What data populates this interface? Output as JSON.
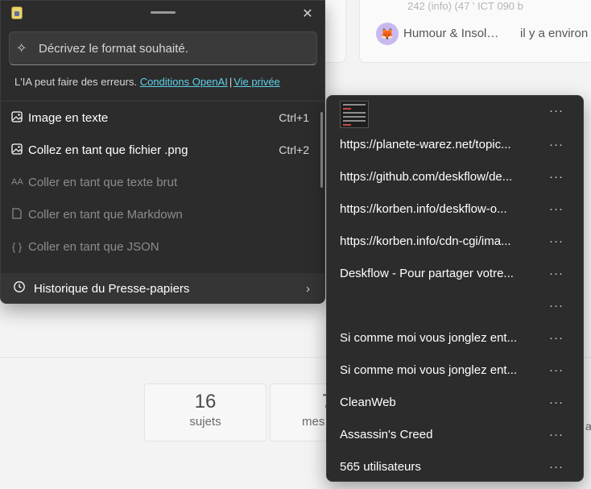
{
  "background": {
    "top_cut_text": "242 (info) (47 ' ICT 090 b",
    "category": "Humour & Insol…",
    "time_text": "il y a environ",
    "stats": [
      {
        "num": "16",
        "label": "sujets"
      },
      {
        "num": "7",
        "label": "mes"
      }
    ],
    "edge_char": "a"
  },
  "paste_menu": {
    "close_glyph": "✕",
    "prompt_placeholder": "Décrivez le format souhaité.",
    "disclaimer": "L'IA peut faire des erreurs.",
    "link_terms": "Conditions OpenAI",
    "separator": "|",
    "link_privacy": "Vie privée",
    "items": [
      {
        "label": "Image en texte",
        "shortcut": "Ctrl+1",
        "icon": "image-icon",
        "enabled": true
      },
      {
        "label": "Collez en tant que fichier .png",
        "shortcut": "Ctrl+2",
        "icon": "image-file-icon",
        "enabled": true
      },
      {
        "label": "Coller en tant que texte brut",
        "shortcut": "",
        "icon": "text-size-icon",
        "enabled": false
      },
      {
        "label": "Coller en tant que Markdown",
        "shortcut": "",
        "icon": "document-icon",
        "enabled": false
      },
      {
        "label": "Coller en tant que JSON",
        "shortcut": "",
        "icon": "braces-icon",
        "enabled": false
      }
    ],
    "history_label": "Historique du Presse-papiers",
    "history_chevron": "›"
  },
  "clipboard_history": {
    "more_glyph": "···",
    "items": [
      {
        "type": "image",
        "text": ""
      },
      {
        "type": "text",
        "text": "https://planete-warez.net/topic..."
      },
      {
        "type": "text",
        "text": "https://github.com/deskflow/de..."
      },
      {
        "type": "text",
        "text": "https://korben.info/deskflow-o..."
      },
      {
        "type": "text",
        "text": "https://korben.info/cdn-cgi/ima..."
      },
      {
        "type": "text",
        "text": "Deskflow - Pour partager votre..."
      },
      {
        "type": "text",
        "text": ""
      },
      {
        "type": "text",
        "text": "Si comme moi vous jonglez ent..."
      },
      {
        "type": "text",
        "text": "Si comme moi vous jonglez ent..."
      },
      {
        "type": "text",
        "text": "CleanWeb"
      },
      {
        "type": "text",
        "text": "Assassin's Creed"
      },
      {
        "type": "text",
        "text": "565 utilisateurs"
      }
    ]
  }
}
